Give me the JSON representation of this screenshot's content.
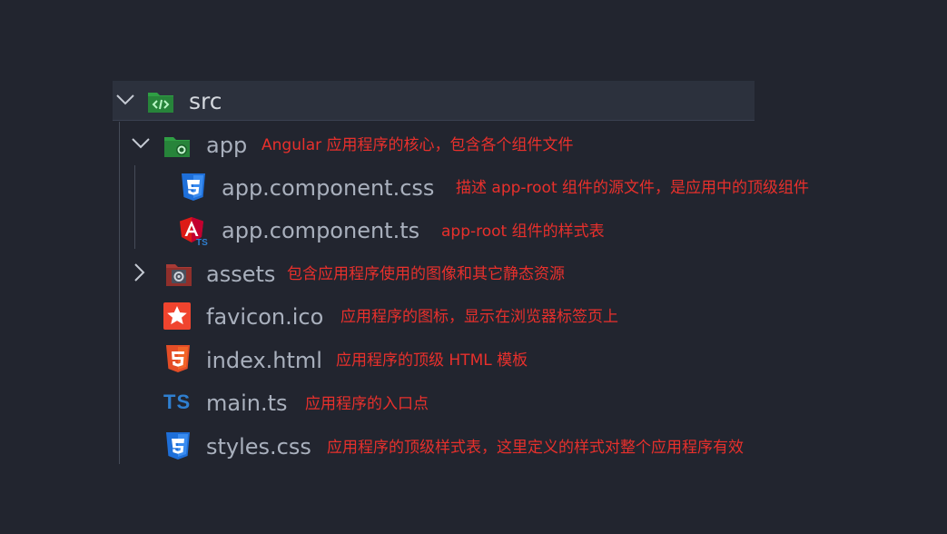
{
  "tree": {
    "root": {
      "name": "src",
      "icon": "folder-src-icon",
      "expanded": true
    },
    "app": {
      "name": "app",
      "icon": "folder-app-icon",
      "expanded": true,
      "note": "Angular 应用程序的核心，包含各个组件文件"
    },
    "app_css": {
      "name": "app.component.css",
      "icon": "css3-icon",
      "note": "描述 app-root 组件的源文件，是应用中的顶级组件"
    },
    "app_ts": {
      "name": "app.component.ts",
      "icon": "angular-icon",
      "note": "app-root 组件的样式表"
    },
    "assets": {
      "name": "assets",
      "icon": "folder-assets-icon",
      "expanded": false,
      "note": "包含应用程序使用的图像和其它静态资源"
    },
    "favicon": {
      "name": "favicon.ico",
      "icon": "favicon-star-icon",
      "note": "应用程序的图标，显示在浏览器标签页上"
    },
    "index": {
      "name": "index.html",
      "icon": "html5-icon",
      "note": "应用程序的顶级 HTML 模板"
    },
    "main": {
      "name": "main.ts",
      "icon": "typescript-icon",
      "icon_text": "TS",
      "note": "应用程序的入口点"
    },
    "styles": {
      "name": "styles.css",
      "icon": "css3-icon",
      "note": "应用程序的顶级样式表，这里定义的样式对整个应用程序有效"
    }
  },
  "colors": {
    "background": "#22252f",
    "selected_row": "#2c313d",
    "filename": "#a9b0bd",
    "note": "#e8302c",
    "css_blue": "#1e6fd9",
    "html_orange": "#e44d26",
    "angular_red": "#dd1b16",
    "ts_blue": "#2f7fd0",
    "folder_green": "#2f9e44"
  }
}
